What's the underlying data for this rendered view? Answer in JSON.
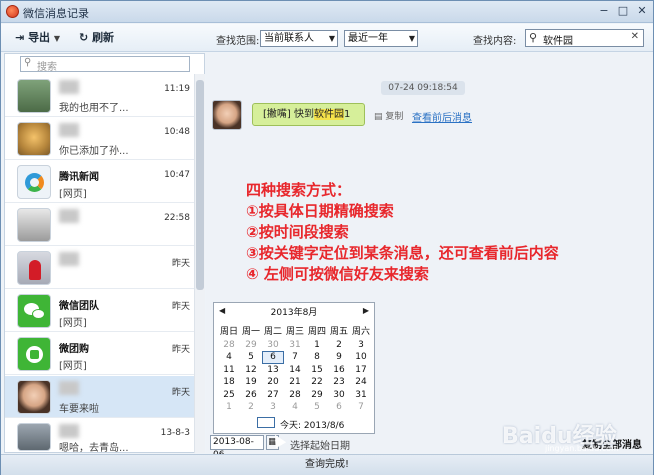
{
  "window": {
    "title": "微信消息记录",
    "min": "−",
    "restore": "□",
    "close": "✕"
  },
  "toolbar": {
    "export_label": "导出",
    "refresh_label": "刷新",
    "range_label": "查找范围:",
    "contact_select": "当前联系人",
    "period_select": "最近一年",
    "content_label": "查找内容:",
    "search_value": "软件园"
  },
  "left": {
    "search_placeholder": "搜索",
    "contacts": [
      {
        "name": "",
        "preview": "我的也用不了...",
        "time": "11:19",
        "avatar": "person-photo"
      },
      {
        "name": "",
        "preview": "你已添加了孙...",
        "time": "10:48",
        "avatar": "child-photo"
      },
      {
        "name": "腾讯新闻",
        "preview": "[网页]",
        "time": "10:47",
        "avatar": "news-icon"
      },
      {
        "name": "",
        "preview": "",
        "time": "22:58",
        "avatar": "photo"
      },
      {
        "name": "",
        "preview": "",
        "time": "昨天",
        "avatar": "red-figure"
      },
      {
        "name": "微信团队",
        "preview": "[网页]",
        "time": "昨天",
        "avatar": "wechat-icon"
      },
      {
        "name": "微团购",
        "preview": "[网页]",
        "time": "昨天",
        "avatar": "tuangou-icon"
      },
      {
        "name": "",
        "preview": "车要来啦",
        "time": "昨天",
        "avatar": "woman-photo"
      },
      {
        "name": "",
        "preview": "嗯哈，去青岛...",
        "time": "13-8-3",
        "avatar": "photo"
      }
    ]
  },
  "chat": {
    "timestamp": "07-24 09:18:54",
    "message_prefix": "[撇嘴] 快到",
    "message_highlight": "软件园",
    "message_suffix": "1",
    "copy_label": "复制",
    "context_link": "查看前后消息"
  },
  "annotations": [
    "四种搜索方式：",
    "①按具体日期精确搜索",
    "②按时间段搜索",
    "③按关键字定位到某条消息，还可查看前后内容",
    "④ 左侧可按微信好友来搜索"
  ],
  "calendar": {
    "month_label": "2013年8月",
    "weekdays": [
      "周日",
      "周一",
      "周二",
      "周三",
      "周四",
      "周五",
      "周六"
    ],
    "weeks": [
      [
        "28",
        "29",
        "30",
        "31",
        "1",
        "2",
        "3"
      ],
      [
        "4",
        "5",
        "6",
        "7",
        "8",
        "9",
        "10"
      ],
      [
        "11",
        "12",
        "13",
        "14",
        "15",
        "16",
        "17"
      ],
      [
        "18",
        "19",
        "20",
        "21",
        "22",
        "23",
        "24"
      ],
      [
        "25",
        "26",
        "27",
        "28",
        "29",
        "30",
        "31"
      ],
      [
        "1",
        "2",
        "3",
        "4",
        "5",
        "6",
        "7"
      ]
    ],
    "selected_day": "6",
    "today_label": "今天: 2013/8/6"
  },
  "bottom": {
    "date_value": "2013-08-06",
    "hint": "选择起始日期",
    "copy_all": "复制全部消息"
  },
  "status": {
    "text": "查询完成!"
  },
  "watermark": {
    "text": "Baidu经验",
    "sub": "jingyan.baidu.com"
  }
}
